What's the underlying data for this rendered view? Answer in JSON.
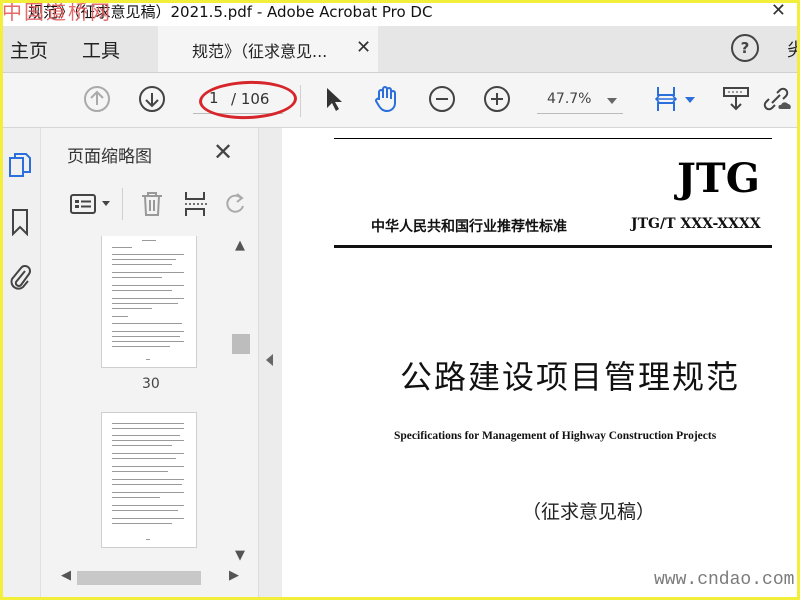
{
  "window": {
    "title": "规范》（征求意见稿）2021.5.pdf - Adobe Acrobat Pro DC",
    "close_glyph": "✕",
    "watermark_top": "中国道桥网"
  },
  "menubar": {
    "home": "主页",
    "tools": "工具",
    "tab_label": "规范》（征求意见...",
    "tab_close": "✕",
    "help": "?",
    "right_cut": "劣"
  },
  "toolbar": {
    "page_current": "1",
    "page_total": "/ 106",
    "zoom": "47.7%",
    "icons": [
      "prev-page-icon",
      "next-page-icon",
      "select-cursor-icon",
      "hand-tool-icon",
      "zoom-out-icon",
      "zoom-in-icon",
      "fit-page-icon",
      "scroll-mode-icon",
      "link-share-icon"
    ]
  },
  "sidebar": {
    "title": "页面缩略图",
    "close": "✕",
    "thumbnails": [
      {
        "page": "30"
      },
      {
        "page": ""
      }
    ],
    "rail_icons": [
      "pages-icon",
      "bookmark-icon",
      "attachment-icon"
    ]
  },
  "document": {
    "logo": "JTG",
    "standard_line": "中华人民共和国行业推荐性标准",
    "code": "JTG/T XXX-XXXX",
    "title_cn": "公路建设项目管理规范",
    "title_en": "Specifications for Management of Highway Construction Projects",
    "draft": "（征求意见稿）"
  },
  "watermark": {
    "bottom_right": "www.cndao.com"
  },
  "colors": {
    "accent_blue": "#2a6fdb",
    "annotation_red": "#d7262b",
    "frame_yellow": "#f2ee3a"
  }
}
